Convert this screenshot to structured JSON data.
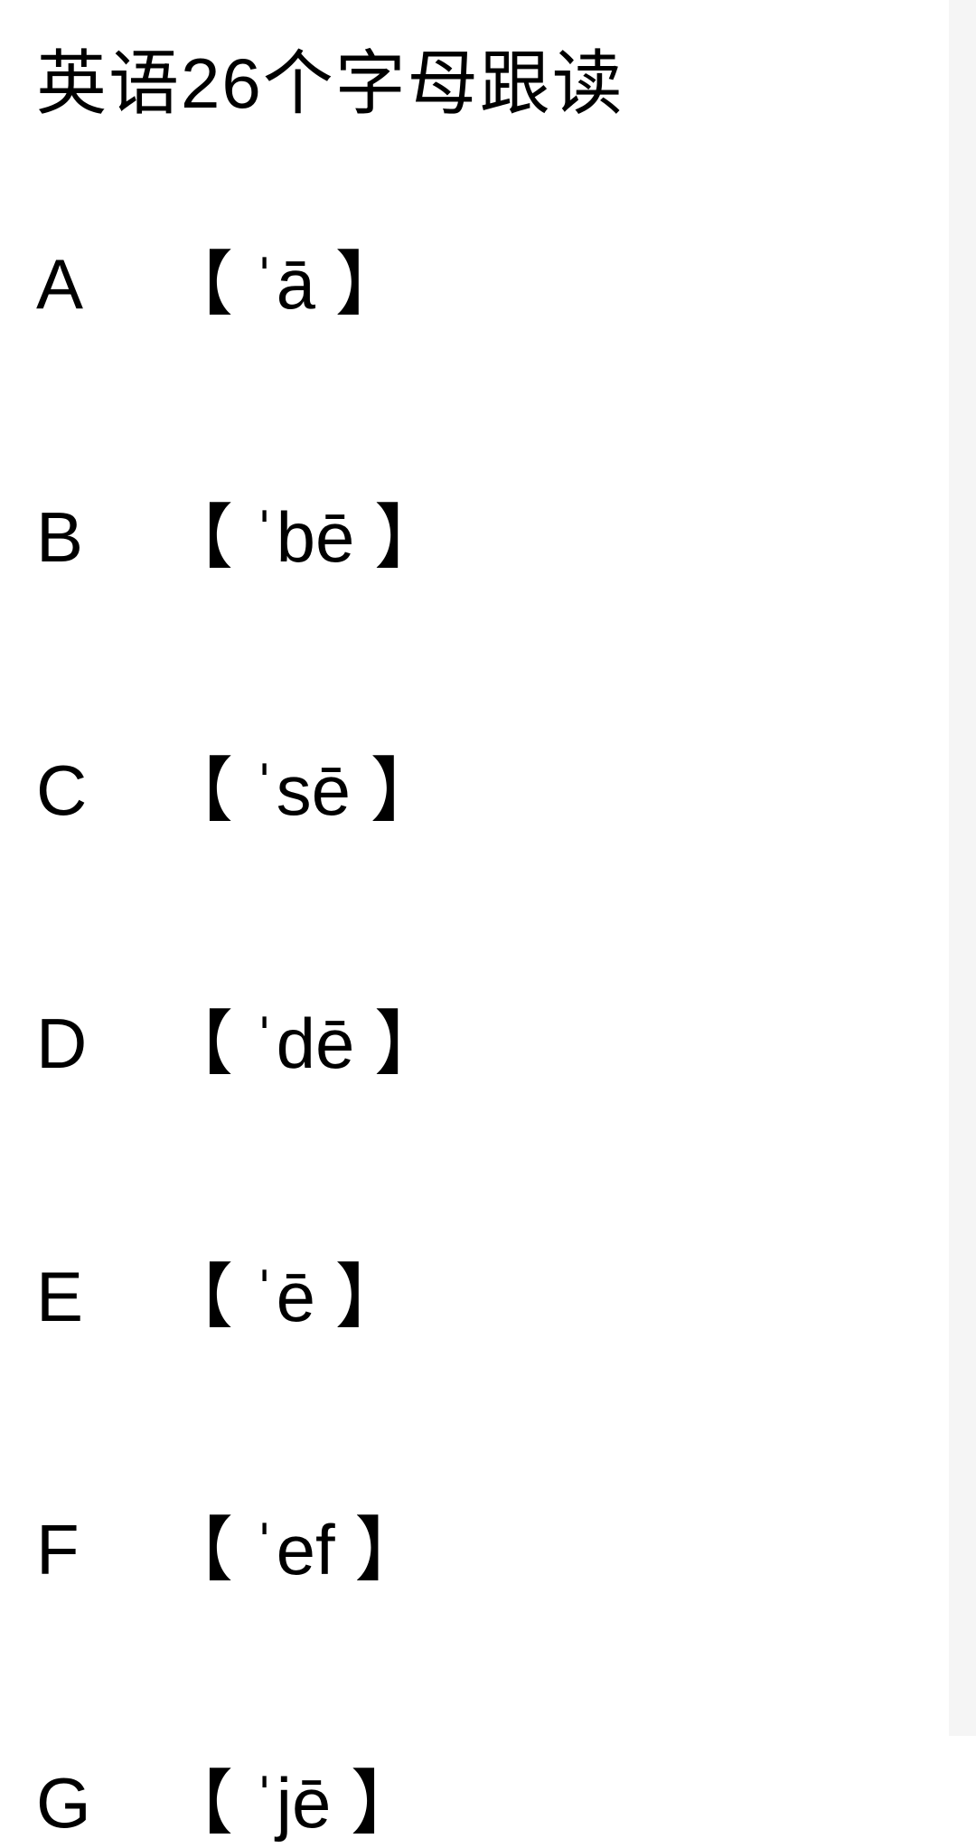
{
  "title": "英语26个字母跟读",
  "letters": [
    {
      "letter": "A",
      "pronunciation": "【 ˈā 】"
    },
    {
      "letter": "B",
      "pronunciation": "【 ˈbē 】"
    },
    {
      "letter": "C",
      "pronunciation": "【 ˈsē 】"
    },
    {
      "letter": "D",
      "pronunciation": "【 ˈdē 】"
    },
    {
      "letter": "E",
      "pronunciation": "【 ˈē 】"
    },
    {
      "letter": "F",
      "pronunciation": "【 ˈef 】"
    },
    {
      "letter": "G",
      "pronunciation": "【 ˈjē 】"
    }
  ]
}
